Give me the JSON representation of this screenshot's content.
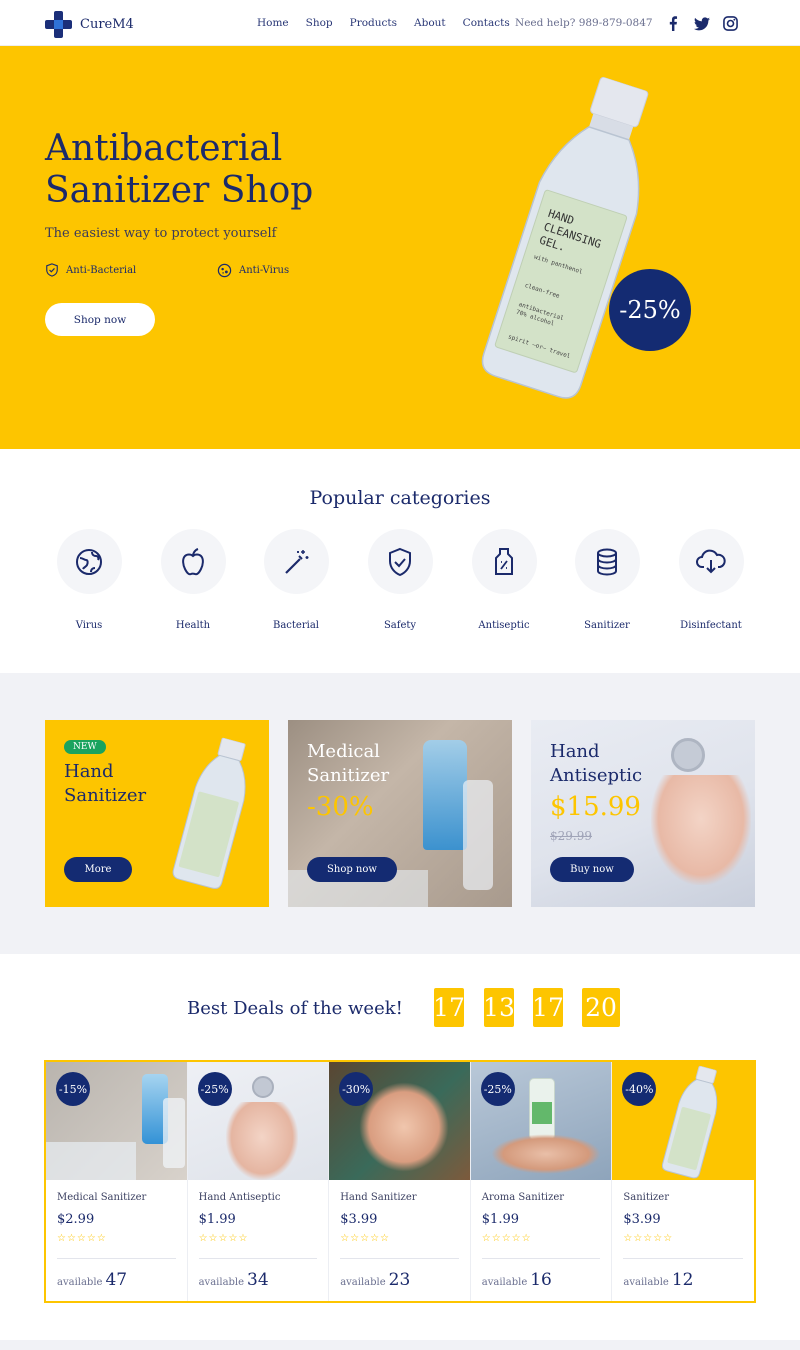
{
  "brand": {
    "name": "CureM4"
  },
  "nav": [
    "Home",
    "Shop",
    "Products",
    "About",
    "Contacts"
  ],
  "help": "Need help? 989-879-0847",
  "socials": [
    "facebook-icon",
    "twitter-icon",
    "instagram-icon"
  ],
  "hero": {
    "title_line1": "Antibacterial",
    "title_line2": "Sanitizer Shop",
    "subtitle": "The easiest way to protect yourself",
    "feature1": "Anti-Bacterial",
    "feature2": "Anti-Virus",
    "button": "Shop now",
    "badge": "-25%",
    "bottle_label": [
      "HAND",
      "CLEANSING",
      "GEL.",
      "with panthenol",
      "clean-free",
      "antibacterial",
      "70% alcohol",
      "spirit —or— travel"
    ]
  },
  "categories": {
    "title": "Popular categories",
    "items": [
      {
        "label": "Virus",
        "icon": "virus-icon"
      },
      {
        "label": "Health",
        "icon": "apple-icon"
      },
      {
        "label": "Bacterial",
        "icon": "magic-wand-icon"
      },
      {
        "label": "Safety",
        "icon": "shield-check-icon"
      },
      {
        "label": "Antiseptic",
        "icon": "bottle-icon"
      },
      {
        "label": "Sanitizer",
        "icon": "database-icon"
      },
      {
        "label": "Disinfectant",
        "icon": "cloud-download-icon"
      }
    ]
  },
  "promos": [
    {
      "badge": "NEW",
      "title_line1": "Hand",
      "title_line2": "Sanitizer",
      "button": "More"
    },
    {
      "title_line1": "Medical",
      "title_line2": "Sanitizer",
      "price": "-30%",
      "button": "Shop now"
    },
    {
      "title_line1": "Hand",
      "title_line2": "Antiseptic",
      "price": "$15.99",
      "old_price": "$29.99",
      "button": "Buy now"
    }
  ],
  "deals": {
    "title": "Best Deals of the week!",
    "timer": [
      "17",
      "13",
      "17",
      "20"
    ]
  },
  "products": [
    {
      "badge": "-15%",
      "name": "Medical Sanitizer",
      "price": "$2.99",
      "stars": "☆☆☆☆☆",
      "available_label": "available",
      "count": "47"
    },
    {
      "badge": "-25%",
      "name": "Hand Antiseptic",
      "price": "$1.99",
      "stars": "☆☆☆☆☆",
      "available_label": "available",
      "count": "34"
    },
    {
      "badge": "-30%",
      "name": "Hand Sanitizer",
      "price": "$3.99",
      "stars": "☆☆☆☆☆",
      "available_label": "available",
      "count": "23"
    },
    {
      "badge": "-25%",
      "name": "Aroma Sanitizer",
      "price": "$1.99",
      "stars": "☆☆☆☆☆",
      "available_label": "available",
      "count": "16"
    },
    {
      "badge": "-40%",
      "name": "Sanitizer",
      "price": "$3.99",
      "stars": "☆☆☆☆☆",
      "available_label": "available",
      "count": "12"
    }
  ],
  "colors": {
    "accent": "#fdc500",
    "navy": "#142b72",
    "green": "#1aa35f",
    "band": "#f1f2f6"
  }
}
